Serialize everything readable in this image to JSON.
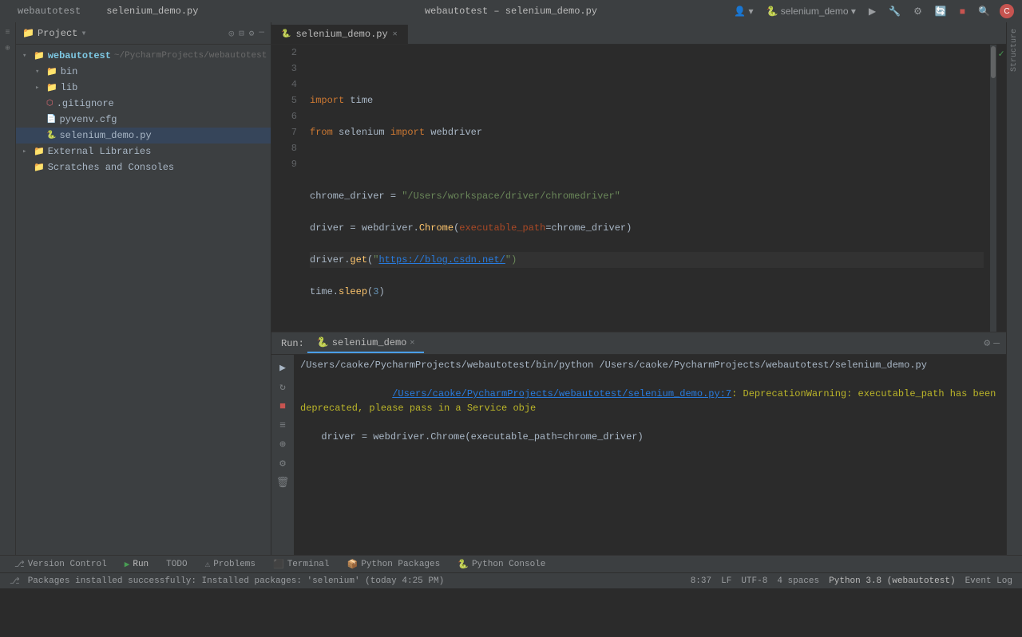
{
  "title_bar": {
    "tabs": [
      {
        "label": "webautotest",
        "active": true
      },
      {
        "label": "selenium_demo.py",
        "has_icon": true,
        "active": false
      }
    ],
    "center_title": "webautotest – selenium_demo.py",
    "right_items": [
      "profile_icon",
      "selenium_demo_dropdown",
      "toolbar_icons",
      "search_icon",
      "avatar_icon"
    ]
  },
  "project_panel": {
    "header_label": "Project",
    "root_item": "webautotest",
    "root_path": "~/PycharmProjects/webautotest",
    "tree": [
      {
        "label": "webautotest",
        "type": "root_folder",
        "expanded": true,
        "indent": 0
      },
      {
        "label": "bin",
        "type": "folder",
        "expanded": true,
        "indent": 1
      },
      {
        "label": "lib",
        "type": "folder",
        "expanded": false,
        "indent": 1
      },
      {
        "label": ".gitignore",
        "type": "file_git",
        "indent": 1
      },
      {
        "label": "pyvenv.cfg",
        "type": "file_cfg",
        "indent": 1
      },
      {
        "label": "selenium_demo.py",
        "type": "file_py",
        "indent": 1,
        "selected": true
      },
      {
        "label": "External Libraries",
        "type": "folder_ext",
        "indent": 0
      },
      {
        "label": "Scratches and Consoles",
        "type": "folder_scratches",
        "indent": 0
      }
    ]
  },
  "editor": {
    "tab_label": "selenium_demo.py",
    "lines": [
      {
        "num": 2,
        "content": ""
      },
      {
        "num": 3,
        "content": "import time",
        "parts": [
          {
            "type": "kw",
            "text": "import"
          },
          {
            "type": "var",
            "text": " time"
          }
        ]
      },
      {
        "num": 4,
        "content": "from selenium import webdriver",
        "parts": [
          {
            "type": "kw",
            "text": "from"
          },
          {
            "type": "var",
            "text": " selenium "
          },
          {
            "type": "kw",
            "text": "import"
          },
          {
            "type": "var",
            "text": " webdriver"
          }
        ]
      },
      {
        "num": 5,
        "content": ""
      },
      {
        "num": 6,
        "content": "chrome_driver = \"/Users/workspace/driver/chromedriver\""
      },
      {
        "num": 7,
        "content": "driver = webdriver.Chrome(executable_path=chrome_driver)"
      },
      {
        "num": 8,
        "content": "driver.get(\"https://blog.csdn.net/\")",
        "has_cursor": true
      },
      {
        "num": 9,
        "content": "time.sleep(3)"
      }
    ]
  },
  "run_panel": {
    "tab_label": "selenium_demo",
    "cmd_line": "/Users/caoke/PycharmProjects/webautotest/bin/python /Users/caoke/PycharmProjects/webautotest/selenium_demo.py",
    "warning_line": "/Users/caoke/PycharmProjects/webautotest/selenium_demo.py:7: DeprecationWarning: executable_path has been deprecated, please pass in a Service obje",
    "code_line": "  driver = webdriver.Chrome(executable_path=chrome_driver)"
  },
  "bottom_toolbar": {
    "tabs": [
      {
        "label": "Version Control",
        "icon": "git-icon",
        "active": false
      },
      {
        "label": "Run",
        "icon": "run-icon",
        "active": true
      },
      {
        "label": "TODO",
        "icon": null,
        "active": false
      },
      {
        "label": "Problems",
        "icon": null,
        "active": false
      },
      {
        "label": "Terminal",
        "icon": null,
        "active": false
      },
      {
        "label": "Python Packages",
        "icon": null,
        "active": false
      },
      {
        "label": "Python Console",
        "icon": null,
        "active": false
      }
    ]
  },
  "status_bar": {
    "message": "Packages installed successfully: Installed packages: 'selenium' (today 4:25 PM)",
    "position": "8:37",
    "encoding": "LF",
    "charset": "UTF-8",
    "indent": "4 spaces",
    "python_version": "Python 3.8 (webautotest)",
    "event_log": "Event Log"
  },
  "icons": {
    "folder_open": "▾📁",
    "folder_closed": "▸📁",
    "python_file": "🐍",
    "play": "▶",
    "stop": "■",
    "rerun": "↻",
    "settings": "⚙",
    "minimize": "—",
    "checkmark": "✓"
  }
}
